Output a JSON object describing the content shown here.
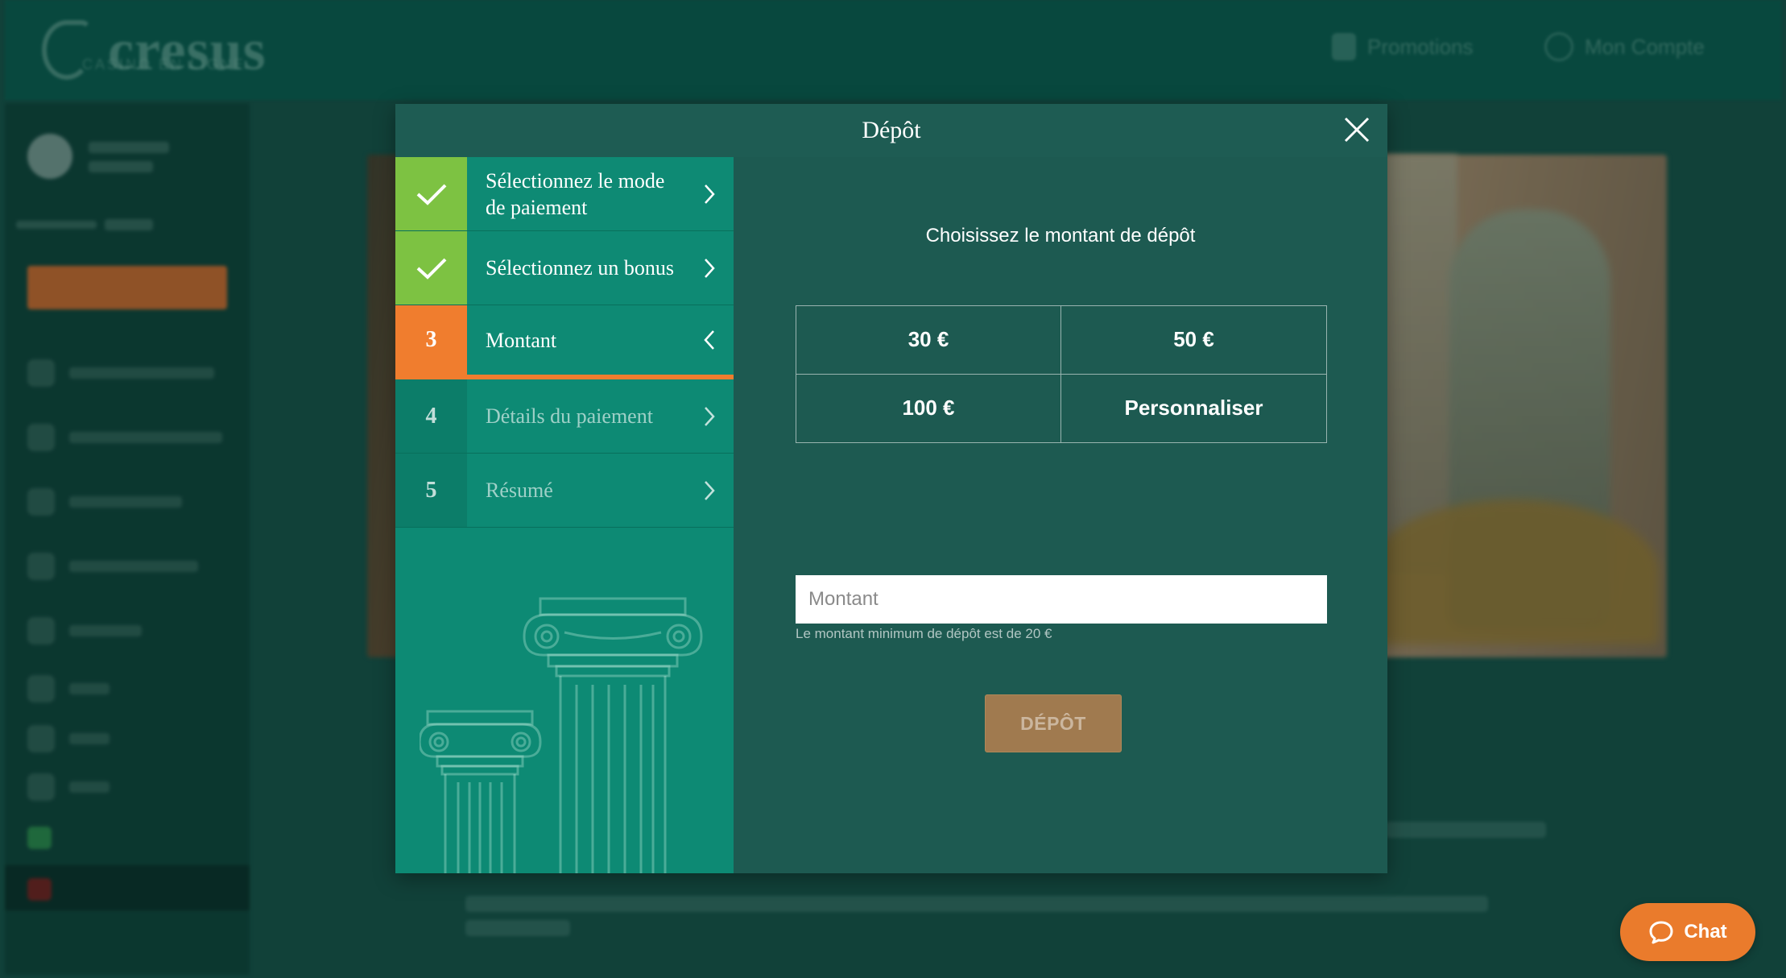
{
  "background": {
    "brand": {
      "name": "cresus",
      "tagline": "CASINO EN LIGNE"
    },
    "header": {
      "promotions_label": "Promotions",
      "account_label": "Mon Compte"
    }
  },
  "modal": {
    "title": "Dépôt",
    "steps": [
      {
        "number": "✓",
        "label": "Sélectionnez le mode de paiement",
        "state": "done"
      },
      {
        "number": "✓",
        "label": "Sélectionnez un bonus",
        "state": "done"
      },
      {
        "number": "3",
        "label": "Montant",
        "state": "active"
      },
      {
        "number": "4",
        "label": "Détails du paiement",
        "state": "pending"
      },
      {
        "number": "5",
        "label": "Résumé",
        "state": "pending"
      }
    ],
    "content": {
      "title": "Choisissez le montant de dépôt",
      "amount_options": [
        "30 €",
        "50 €",
        "100 €",
        "Personnaliser"
      ],
      "amount_input": {
        "placeholder": "Montant",
        "value": ""
      },
      "hint": "Le montant minimum de dépôt est de 20 €",
      "deposit_button": "DÉPÔT"
    }
  },
  "chat": {
    "label": "Chat"
  },
  "colors": {
    "accent_orange": "#f07d2e",
    "done_green": "#7dc242",
    "steps_teal": "#0d8a74",
    "modal_bg": "#1d5a51"
  }
}
